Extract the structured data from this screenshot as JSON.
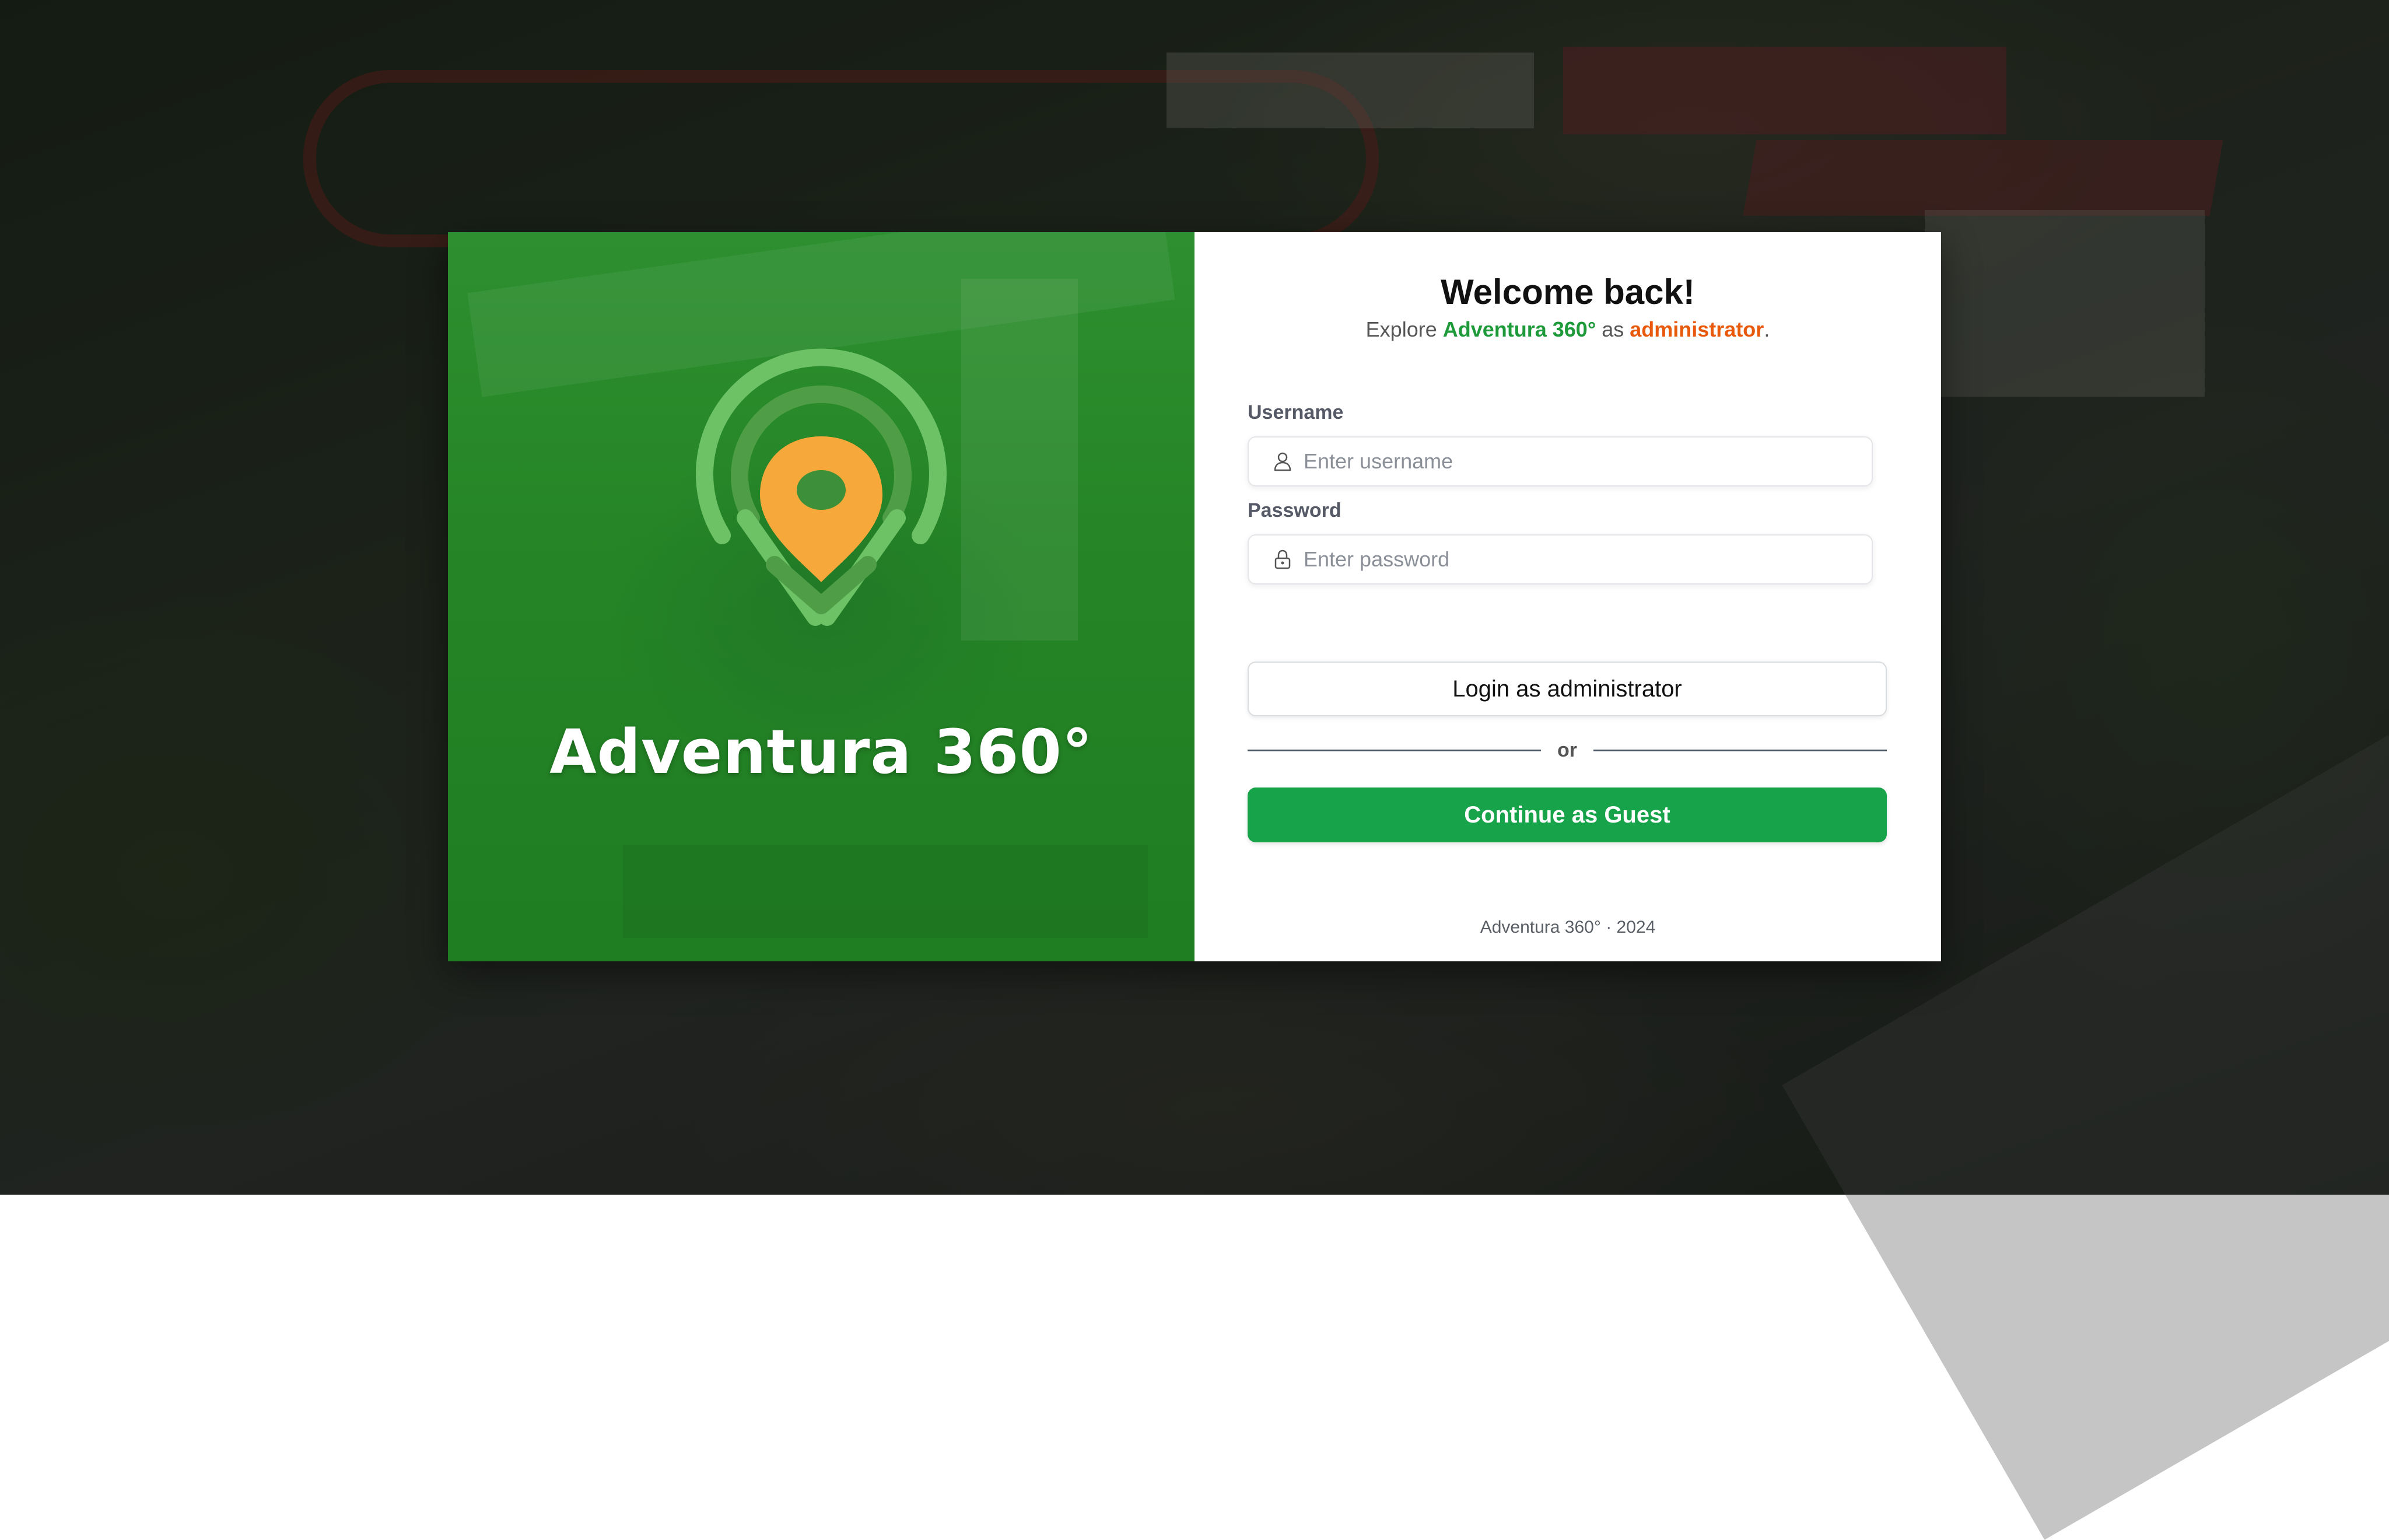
{
  "brand": {
    "name": "Adventura 360°",
    "colors": {
      "green": "#2d8f2f",
      "accent_orange": "#f7a83a",
      "light_green": "#6cc264"
    }
  },
  "form": {
    "welcome": "Welcome back!",
    "subtitle_prefix": "Explore ",
    "subtitle_brand": "Adventura 360°",
    "subtitle_middle": " as ",
    "subtitle_role": "administrator",
    "subtitle_suffix": ".",
    "username_label": "Username",
    "username_placeholder": "Enter username",
    "username_icon": "user-icon",
    "password_label": "Password",
    "password_placeholder": "Enter password",
    "password_icon": "lock-icon",
    "login_button": "Login as administrator",
    "divider_text": "or",
    "guest_button": "Continue as Guest",
    "footer": "Adventura 360° · 2024"
  },
  "colors": {
    "primary_green": "#16a34a",
    "highlight_green": "#1e9a3a",
    "highlight_orange": "#e8590c"
  }
}
